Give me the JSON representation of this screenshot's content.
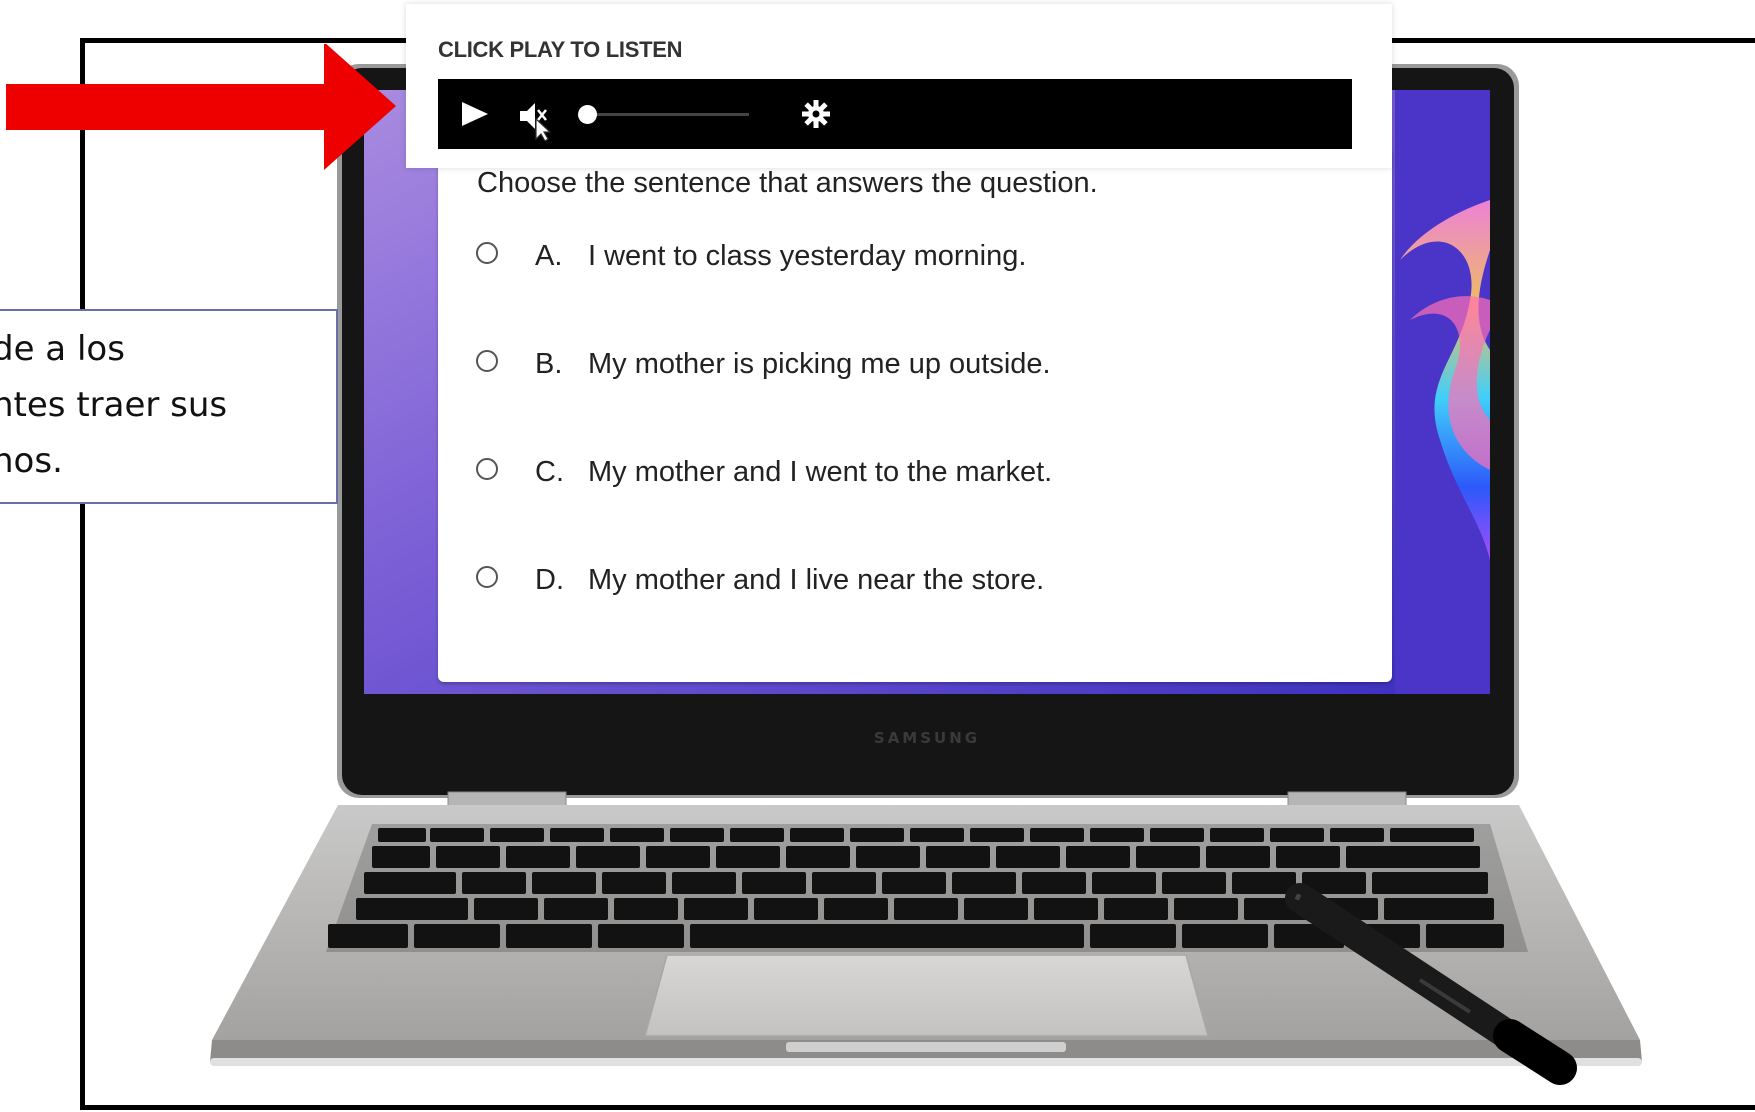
{
  "audio_panel": {
    "title": "CLICK PLAY TO LISTEN",
    "controls": {
      "play_icon": "play-icon",
      "mute_icon": "muted-speaker-icon",
      "settings_icon": "gear-icon",
      "volume_level": 0
    }
  },
  "question": {
    "prompt": "Choose the sentence that answers the question.",
    "options": [
      {
        "letter": "A.",
        "text": "I went to class yesterday morning."
      },
      {
        "letter": "B.",
        "text": "My mother is picking me up outside."
      },
      {
        "letter": "C.",
        "text": "My mother and I went to the market."
      },
      {
        "letter": "D.",
        "text": "My mother and I live near the store."
      }
    ]
  },
  "note": {
    "lines": [
      "de a los",
      "ntes traer sus",
      "nos."
    ]
  },
  "laptop": {
    "brand": "SAMSUNG"
  },
  "colors": {
    "arrow": "#ee0000",
    "player_bar": "#000000",
    "note_border": "#6b6fa8"
  }
}
